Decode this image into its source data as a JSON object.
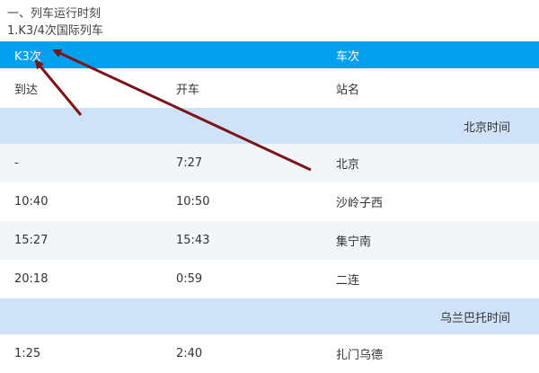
{
  "heading": {
    "section": "一、列车运行时刻",
    "subsection": "1.K3/4次国际列车"
  },
  "table": {
    "header": {
      "train": "K3次",
      "train_label": "车次"
    },
    "columns": {
      "arrive": "到达",
      "depart": "开车",
      "station": "站名"
    },
    "sections": [
      {
        "label": "北京时间",
        "rows": [
          {
            "arrive": "-",
            "depart": "7:27",
            "station": "北京"
          },
          {
            "arrive": "10:40",
            "depart": "10:50",
            "station": "沙岭子西"
          },
          {
            "arrive": "15:27",
            "depart": "15:43",
            "station": "集宁南"
          },
          {
            "arrive": "20:18",
            "depart": "0:59",
            "station": "二连"
          }
        ]
      },
      {
        "label": "乌兰巴托时间",
        "rows": [
          {
            "arrive": "1:25",
            "depart": "2:40",
            "station": "扎门乌德"
          }
        ]
      }
    ]
  },
  "annotation": {
    "arrow_color": "#7b1418"
  }
}
